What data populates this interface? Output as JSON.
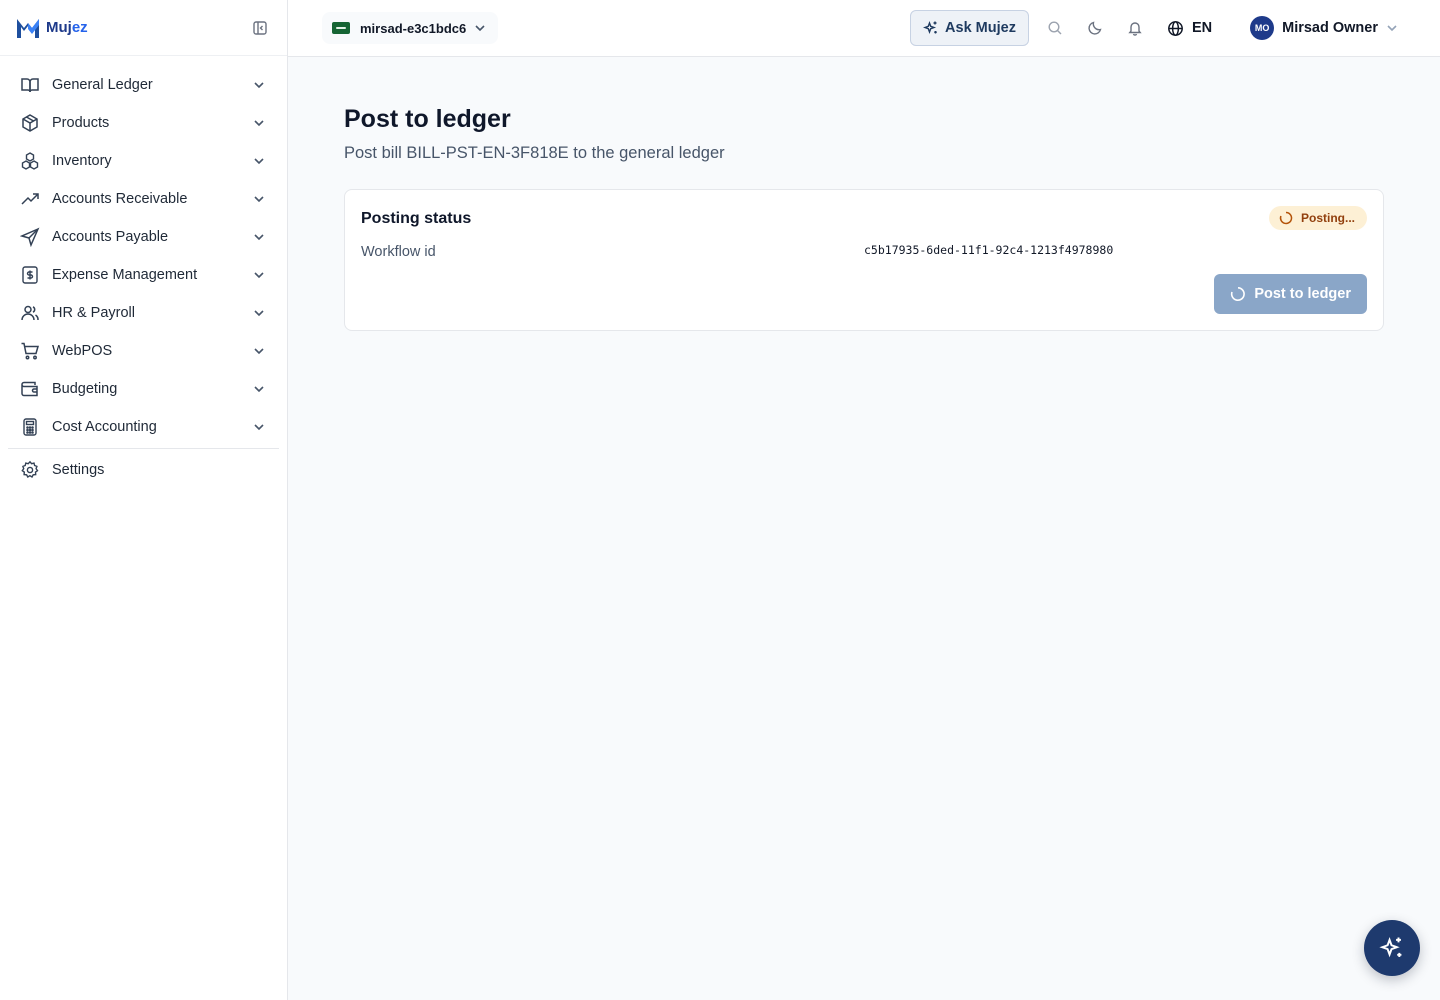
{
  "brand": {
    "name_main": "Muj",
    "name_accent": "ez"
  },
  "sidebar": {
    "items": [
      {
        "label": "General Ledger",
        "icon": "book-open-icon"
      },
      {
        "label": "Products",
        "icon": "package-icon"
      },
      {
        "label": "Inventory",
        "icon": "boxes-icon"
      },
      {
        "label": "Accounts Receivable",
        "icon": "trending-up-icon"
      },
      {
        "label": "Accounts Payable",
        "icon": "send-icon"
      },
      {
        "label": "Expense Management",
        "icon": "receipt-dollar-icon"
      },
      {
        "label": "HR & Payroll",
        "icon": "users-icon"
      },
      {
        "label": "WebPOS",
        "icon": "shopping-cart-icon"
      },
      {
        "label": "Budgeting",
        "icon": "wallet-icon"
      },
      {
        "label": "Cost Accounting",
        "icon": "calculator-icon"
      }
    ],
    "settings_label": "Settings"
  },
  "topbar": {
    "org_name": "mirsad-e3c1bdc6",
    "ask_label": "Ask Mujez",
    "lang_label": "EN",
    "user_initials": "MO",
    "user_name": "Mirsad Owner"
  },
  "page": {
    "title": "Post to ledger",
    "subtitle": "Post bill BILL-PST-EN-3F818E to the general ledger"
  },
  "card": {
    "title": "Posting status",
    "status_badge": "Posting...",
    "workflow_label": "Workflow id",
    "workflow_value": "c5b17935-6ded-11f1-92c4-1213f4978980",
    "button_label": "Post to ledger"
  },
  "colors": {
    "brand": "#1e3a8a",
    "badge_bg": "#fdf0d5",
    "badge_text": "#92400e",
    "button_disabled": "#8aa6c8",
    "fab": "#1e3a6e"
  }
}
